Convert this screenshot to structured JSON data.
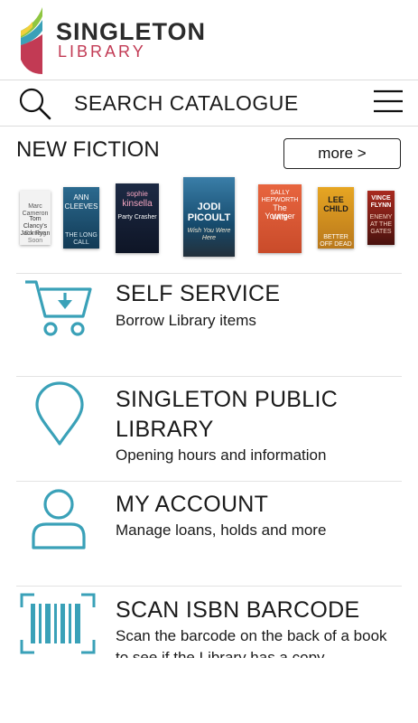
{
  "header": {
    "logo_title": "SINGLETON",
    "logo_subtitle": "LIBRARY",
    "brand_color": "#c23a54",
    "accent_color": "#3aa1b8"
  },
  "search": {
    "label": "SEARCH CATALOGUE",
    "icon": "search-icon",
    "menu_icon": "hamburger-menu-icon"
  },
  "new_fiction": {
    "title": "NEW FICTION",
    "more_label": "more >",
    "books": [
      {
        "line1": "Marc Cameron",
        "line2": "Tom Clancy's Jack Ryan",
        "line3": "Coming Soon"
      },
      {
        "line1": "ANN",
        "line2": "CLEEVES",
        "line3": "THE LONG CALL"
      },
      {
        "line1": "sophie",
        "line2": "kinsella",
        "line3": "Party Crasher"
      },
      {
        "line1": "JODI",
        "line2": "PICOULT",
        "line3": "Wish You Were Here"
      },
      {
        "line1": "SALLY HEPWORTH",
        "line2": "The Younger",
        "line3": "Wife"
      },
      {
        "line1": "LEE",
        "line2": "CHILD",
        "line3": "BETTER OFF DEAD"
      },
      {
        "line1": "VINCE",
        "line2": "FLYNN",
        "line3": "ENEMY AT THE GATES"
      }
    ]
  },
  "menu": [
    {
      "title": "SELF SERVICE",
      "desc": "Borrow Library items",
      "icon": "shopping-cart-icon"
    },
    {
      "title": "SINGLETON PUBLIC LIBRARY",
      "title_line1": "SINGLETON PUBLIC",
      "title_line2": "LIBRARY",
      "desc": "Opening hours and information",
      "icon": "location-pin-icon"
    },
    {
      "title": "MY ACCOUNT",
      "desc": "Manage loans, holds and more",
      "icon": "user-icon"
    },
    {
      "title": "SCAN ISBN BARCODE",
      "desc": "Scan the barcode on the back of a book",
      "desc2": "to see if the Library has a copy",
      "icon": "barcode-scan-icon"
    }
  ]
}
